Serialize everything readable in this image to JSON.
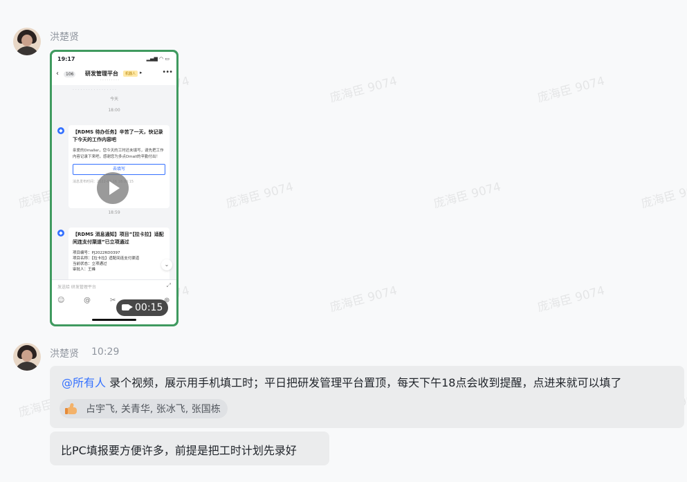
{
  "watermark": "庞海臣 9074",
  "messages": [
    {
      "sender": "洪楚贤",
      "video": {
        "duration": "00:15",
        "phone": {
          "status_time": "19:17",
          "back_count": "106",
          "chat_title": "研发管理平台",
          "bot_tag": "机器人",
          "today": "今天",
          "time1": "18:00",
          "card1": {
            "title": "【RDMS 待办任务】辛苦了一天，快记录下今天的工作内容吧",
            "body": "亲爱的Dmaller，您今天的工时还未填写，请先把工作内容记录下来吧，感谢您为多点Dmall的辛勤付出！",
            "button": "去填写",
            "footer": "消息发布时间：2022-02-16 18:00:15"
          },
          "time2": "18:59",
          "card2": {
            "title": "【RDMS 消息通知】项目”【拉卡拉】适配间连支付渠道”已立项通过",
            "fields": [
              "项目编号：PJ2022RD0397",
              "项目名称：【拉卡拉】适配间连支付渠道",
              "当前状态：立项通过",
              "审批人：王峰"
            ]
          },
          "input_placeholder": "发送给 研发管理平台"
        }
      }
    },
    {
      "sender": "洪楚贤",
      "time": "10:29",
      "bubble1": {
        "mention": "@所有人",
        "text": " 录个视频，展示用手机填工时；平日把研发管理平台置顶，每天下午18点会收到提醒，点进来就可以填了",
        "reaction_names": "占宇飞, 关青华, 张冰飞, 张国栋"
      },
      "bubble2": {
        "text": "比PC填报要方便许多，前提是把工时计划先录好"
      }
    }
  ]
}
